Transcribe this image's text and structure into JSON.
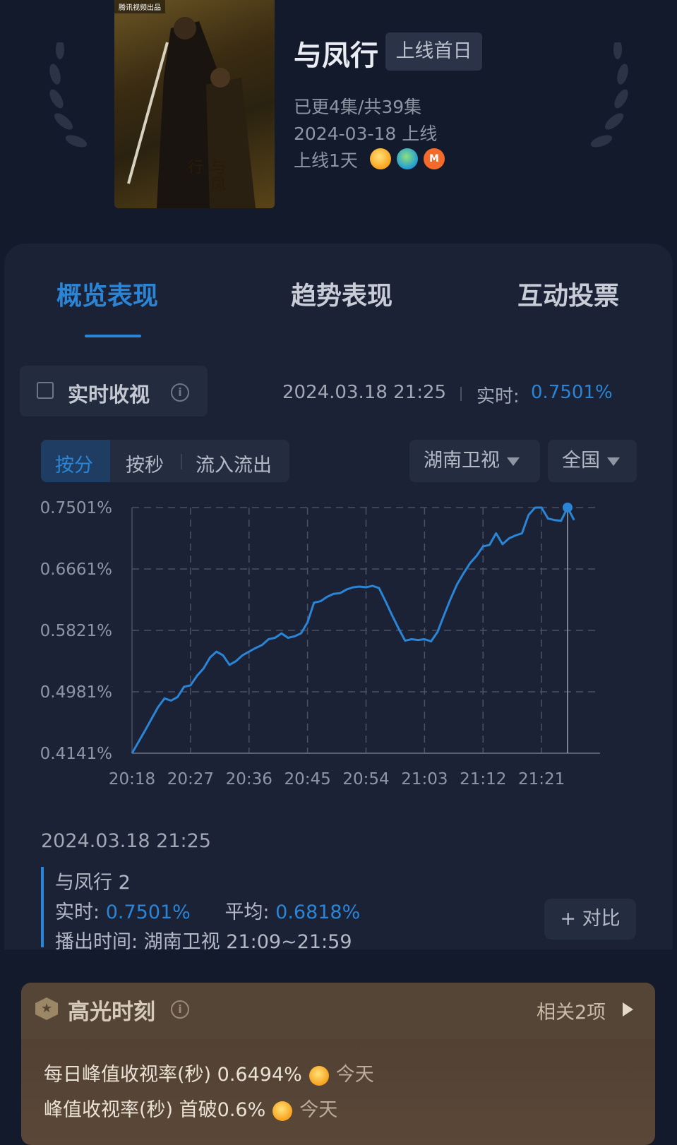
{
  "show": {
    "poster_badge": "腾讯视频出品",
    "poster_logo": "与凤行",
    "title": "与凤行",
    "tag": "上线首日",
    "episodes": "已更4集/共39集",
    "release": "2024-03-18 上线",
    "days_online": "上线1天",
    "platforms": [
      {
        "icon": "mango-tv-coin-icon"
      },
      {
        "icon": "tencent-video-icon"
      },
      {
        "icon": "mgtv-icon",
        "text": "M"
      }
    ]
  },
  "tabs": [
    {
      "label": "概览表现",
      "active": true
    },
    {
      "label": "趋势表现",
      "active": false
    },
    {
      "label": "互动投票",
      "active": false
    }
  ],
  "realtime": {
    "label": "实时收视",
    "timestamp": "2024.03.18 21:25",
    "live_label": "实时:",
    "live_value": "0.7501%"
  },
  "segments": [
    {
      "label": "按分",
      "active": true
    },
    {
      "label": "按秒",
      "active": false
    },
    {
      "label": "流入流出",
      "active": false
    }
  ],
  "filters": {
    "channel": "湖南卫视",
    "region": "全国"
  },
  "colors": {
    "accent": "#2b85d6",
    "background": "#131a2b",
    "card": "#1b2236",
    "highlight": "#554536"
  },
  "chart_data": {
    "type": "line",
    "title": "",
    "xlabel": "",
    "ylabel": "",
    "y_ticks": [
      "0.7501%",
      "0.6661%",
      "0.5821%",
      "0.4981%",
      "0.4141%"
    ],
    "x_ticks": [
      "20:18",
      "20:27",
      "20:36",
      "20:45",
      "20:54",
      "21:03",
      "21:12",
      "21:21"
    ],
    "ylim": [
      0.4141,
      0.7501
    ],
    "x_minutes_from": "20:18",
    "x": [
      "20:18",
      "20:20",
      "20:22",
      "20:23",
      "20:24",
      "20:25",
      "20:26",
      "20:27",
      "20:28",
      "20:29",
      "20:30",
      "20:31",
      "20:32",
      "20:33",
      "20:34",
      "20:35",
      "20:36",
      "20:37",
      "20:38",
      "20:39",
      "20:40",
      "20:41",
      "20:42",
      "20:43",
      "20:44",
      "20:45",
      "20:46",
      "20:47",
      "20:48",
      "20:49",
      "20:50",
      "20:51",
      "20:52",
      "20:53",
      "20:54",
      "20:55",
      "20:56",
      "20:57",
      "20:58",
      "20:59",
      "21:00",
      "21:01",
      "21:02",
      "21:03",
      "21:04",
      "21:05",
      "21:06",
      "21:07",
      "21:08",
      "21:09",
      "21:10",
      "21:11",
      "21:12",
      "21:13",
      "21:14",
      "21:15",
      "21:16",
      "21:17",
      "21:18",
      "21:19",
      "21:20",
      "21:21",
      "21:22",
      "21:23",
      "21:24",
      "21:25",
      "21:26"
    ],
    "series": [
      {
        "values": [
          0.4141,
          0.445,
          0.477,
          0.489,
          0.486,
          0.491,
          0.505,
          0.507,
          0.52,
          0.53,
          0.545,
          0.553,
          0.548,
          0.535,
          0.54,
          0.548,
          0.553,
          0.558,
          0.562,
          0.57,
          0.572,
          0.578,
          0.572,
          0.574,
          0.578,
          0.593,
          0.62,
          0.622,
          0.628,
          0.632,
          0.633,
          0.638,
          0.641,
          0.642,
          0.641,
          0.643,
          0.64,
          0.622,
          0.603,
          0.585,
          0.568,
          0.57,
          0.569,
          0.57,
          0.567,
          0.58,
          0.603,
          0.625,
          0.645,
          0.66,
          0.674,
          0.684,
          0.697,
          0.699,
          0.715,
          0.7,
          0.708,
          0.712,
          0.715,
          0.74,
          0.75,
          0.7501,
          0.735,
          0.733,
          0.732,
          0.7501,
          0.733
        ]
      }
    ],
    "grid": true
  },
  "detail": {
    "date": "2024.03.18 21:25",
    "episode": "与凤行 2",
    "live_label": "实时:",
    "live_value": "0.7501%",
    "avg_label": "平均:",
    "avg_value": "0.6818%",
    "airtime": "播出时间:  湖南卫视 21:09~21:59",
    "compare": "+ 对比"
  },
  "highlights": {
    "title": "高光时刻",
    "related": "相关2项",
    "items": [
      {
        "text": "每日峰值收视率(秒) 0.6494%",
        "when": "今天"
      },
      {
        "text": "峰值收视率(秒) 首破0.6%",
        "when": "今天"
      }
    ]
  }
}
